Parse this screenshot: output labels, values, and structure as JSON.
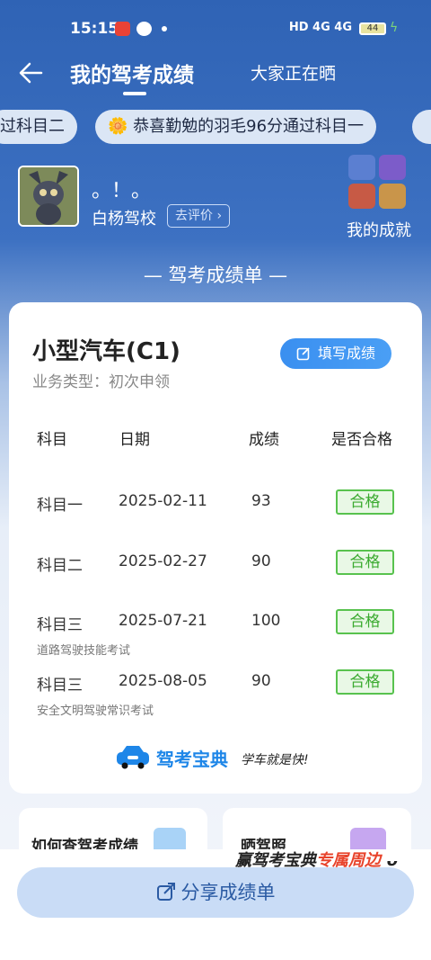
{
  "status_bar": {
    "time": "15:15",
    "network": "HD 4G 4G",
    "battery": "44"
  },
  "nav": {
    "title": "我的驾考成绩",
    "tab_share": "大家正在晒"
  },
  "ticker": {
    "left_fragment": "过科目二",
    "main_message": "恭喜勤勉的羽毛96分通过科目一"
  },
  "profile": {
    "username": "。！。",
    "school": "白杨驾校",
    "review_button": "去评价",
    "achievements_label": "我的成就"
  },
  "sheet_title": "— 驾考成绩单 —",
  "card": {
    "vehicle": "小型汽车(C1)",
    "business_type": "业务类型：初次申领",
    "fill_button": "填写成绩",
    "headers": {
      "subject": "科目",
      "date": "日期",
      "score": "成绩",
      "passed": "是否合格"
    },
    "rows": [
      {
        "subject": "科目一",
        "date": "2025-02-11",
        "score": "93",
        "status": "合格",
        "note": ""
      },
      {
        "subject": "科目二",
        "date": "2025-02-27",
        "score": "90",
        "status": "合格",
        "note": ""
      },
      {
        "subject": "科目三",
        "date": "2025-07-21",
        "score": "100",
        "status": "合格",
        "note": "道路驾驶技能考试"
      },
      {
        "subject": "科目三",
        "date": "2025-08-05",
        "score": "90",
        "status": "合格",
        "note": "安全文明驾驶常识考试"
      }
    ],
    "brand": "驾考宝典",
    "slogan": "学车就是快!"
  },
  "bottom": {
    "card1_title": "如何查驾考成绩",
    "card2_title": "晒驾照",
    "promo_prefix": "赢驾考宝典",
    "promo_highlight": "专属周边",
    "share_button": "分享成绩单"
  },
  "colors": {
    "primary": "#2f63b5",
    "pass_green": "#3aaa2f",
    "button_blue": "#3a8ff0"
  }
}
